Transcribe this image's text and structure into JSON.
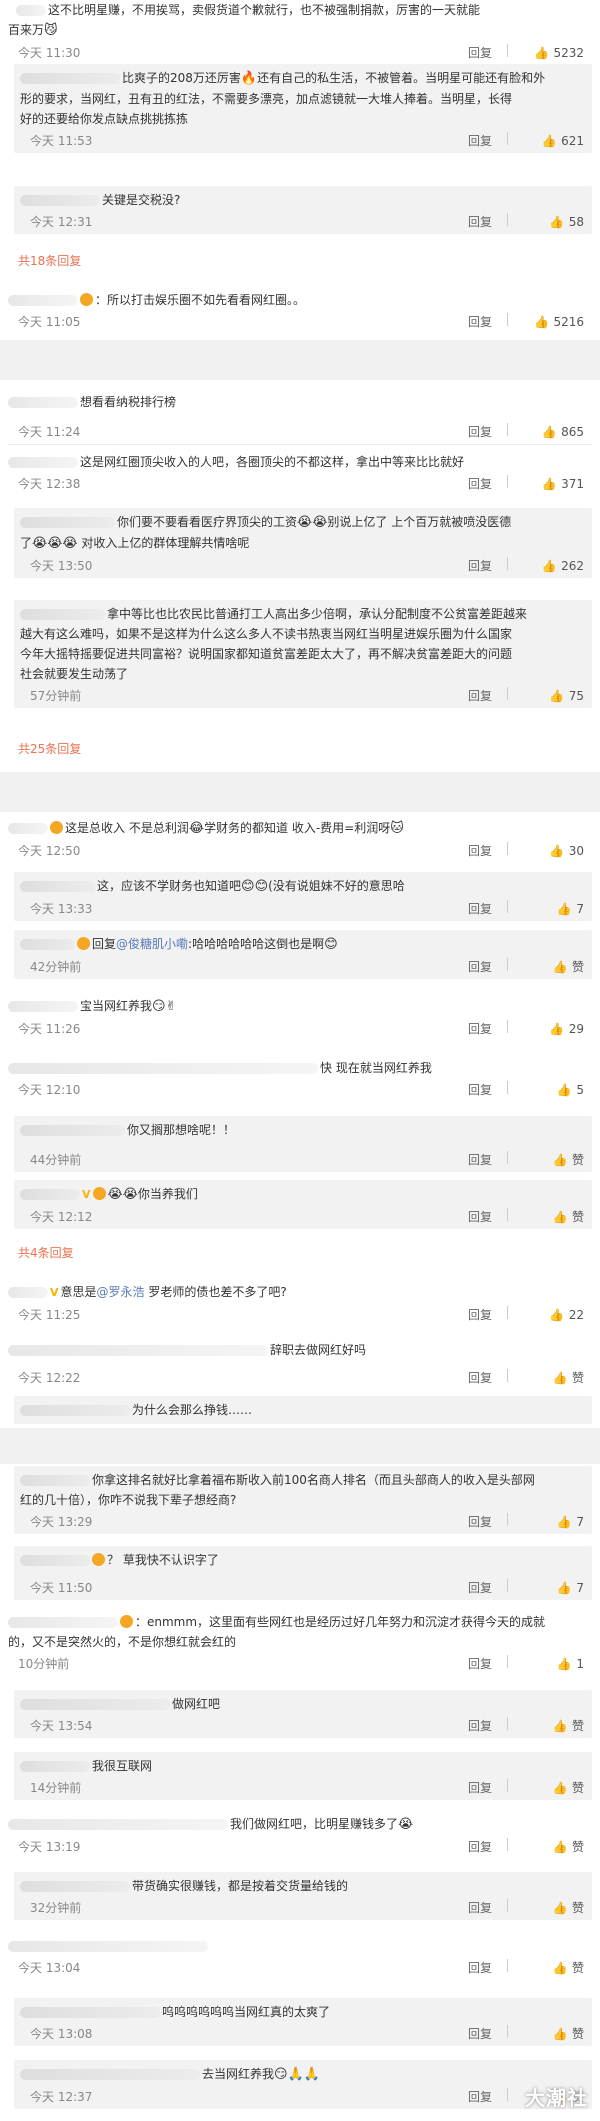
{
  "labels": {
    "reply": "回复",
    "like_icon": "thumbs-up-icon"
  },
  "block1": {
    "c1": {
      "text": "这不比明星赚，不用挨骂，卖假货道个歉就行，也不被强制捐款，厉害的一天就能",
      "text2": "百来万",
      "time": "今天 11:30",
      "likes": "5232"
    },
    "c2": {
      "text": "比爽子的208万还厉害",
      "text_b": "还有自己的私生活，不被管着。当明星可能还有脸和外",
      "text2": "形的要求，当网红，丑有丑的红法，不需要多漂亮，加点滤镜就一大堆人捧着。当明星，长得",
      "text3": "好的还要给你发点缺点挑挑拣拣",
      "time": "今天 11:53",
      "likes": "621"
    },
    "c3": {
      "text": "关键是交税没?",
      "time": "今天 12:31",
      "likes": "58"
    },
    "more": "共18条回复",
    "c4": {
      "text": "：所以打击娱乐圈不如先看看网红圈。。",
      "time": "今天 11:05",
      "likes": "5216"
    }
  },
  "block2": {
    "c1": {
      "text": "想看看纳税排行榜",
      "time": "今天 11:24",
      "likes": "865"
    },
    "c2": {
      "text": "这是网红圈顶尖收入的人吧，各圈顶尖的不都这样，拿出中等来比比就好",
      "time": "今天 12:38",
      "likes": "371"
    },
    "c3": {
      "text": "你们要不要看看医疗界顶尖的工资",
      "text_b": "别说上亿了  上个百万就被喷没医德",
      "text2": "了",
      "text2_b": " 对收入上亿的群体理解共情啥呢",
      "time": "今天 13:50",
      "likes": "262"
    },
    "c4": {
      "text": "拿中等比也比农民比普通打工人高出多少倍啊，承认分配制度不公贫富差距越来",
      "text2": "越大有这么难吗，如果不是这样为什么这么多人不读书热衷当网红当明星进娱乐圈为什么国家",
      "text3": "今年大摇特摇要促进共同富裕？说明国家都知道贫富差距太大了，再不解决贫富差距大的问题",
      "text4": "社会就要发生动荡了",
      "time": "57分钟前",
      "likes": "75"
    },
    "more": "共25条回复"
  },
  "block3": {
    "c1": {
      "text": "这是总收入 不是总利润",
      "text_b": "学财务的都知道 收入-费用=利润呀",
      "time": "今天 12:50",
      "likes": "30"
    },
    "c2": {
      "text": "这，应该不学财务也知道吧",
      "text_b": "(没有说姐妹不好的意思哈",
      "time": "今天 13:33",
      "likes": "7"
    },
    "c3": {
      "prefix": "回复",
      "mention": "@俊糖肌小嘞",
      "text": ":哈哈哈哈哈哈这倒也是啊",
      "time": "42分钟前",
      "likes": "赞"
    },
    "c4": {
      "text": "宝当网红养我",
      "time": "今天 11:26",
      "likes": "29"
    },
    "c5": {
      "text": "快 现在就当网红养我",
      "time": "今天 12:10",
      "likes": "5"
    },
    "c6": {
      "text": "你又搁那想啥呢！！",
      "time": "44分钟前",
      "likes": "赞"
    },
    "c7": {
      "text": "你当养我们",
      "time": "今天 12:12",
      "likes": "赞"
    },
    "more": "共4条回复",
    "c8": {
      "text": "意思是",
      "mention": "@罗永浩",
      "text_b": " 罗老师的债也差不多了吧?",
      "time": "今天 11:25",
      "likes": "22"
    },
    "c9": {
      "text": "辞职去做网红好吗",
      "time": "今天 12:22",
      "likes": "赞"
    },
    "c10": {
      "text": "为什么会那么挣钱……"
    }
  },
  "block4": {
    "c1": {
      "text": "你拿这排名就好比拿着福布斯收入前100名商人排名（而且头部商人的收入是头部网",
      "text2": "红的几十倍），你咋不说我下辈子想经商?",
      "time": "今天 13:29",
      "likes": "7"
    },
    "c2": {
      "text": "？ 草我快不认识字了",
      "time": "今天 11:50",
      "likes": "7"
    },
    "c3": {
      "text": "：enmmm，这里面有些网红也是经历过好几年努力和沉淀才获得今天的成就",
      "text2": "的，又不是突然火的，不是你想红就会红的",
      "time": "10分钟前",
      "likes": "1"
    },
    "c4": {
      "text": "做网红吧",
      "time": "今天 13:54",
      "likes": "赞"
    },
    "c5": {
      "text": "我很互联网",
      "time": "14分钟前",
      "likes": "赞"
    },
    "c6": {
      "text": "我们做网红吧，比明星赚钱多了",
      "time": "今天 13:19",
      "likes": "赞"
    },
    "c7": {
      "text": "带货确实很赚钱，都是按着交货量给钱的",
      "time": "32分钟前",
      "likes": "赞"
    },
    "c8": {
      "time": "今天 13:04",
      "likes": "赞"
    },
    "c9": {
      "text": "呜呜呜呜呜呜当网红真的太爽了",
      "time": "今天 13:08",
      "likes": "赞"
    },
    "c10": {
      "text": "去当网红养我",
      "time": "今天 12:37",
      "likes": "赞"
    }
  },
  "watermark": "大潮社",
  "colors": {
    "link": "#eb7350",
    "mention": "#5a7bb8",
    "sub_bg": "#f2f2f2",
    "divider": "#f0f0f0"
  }
}
